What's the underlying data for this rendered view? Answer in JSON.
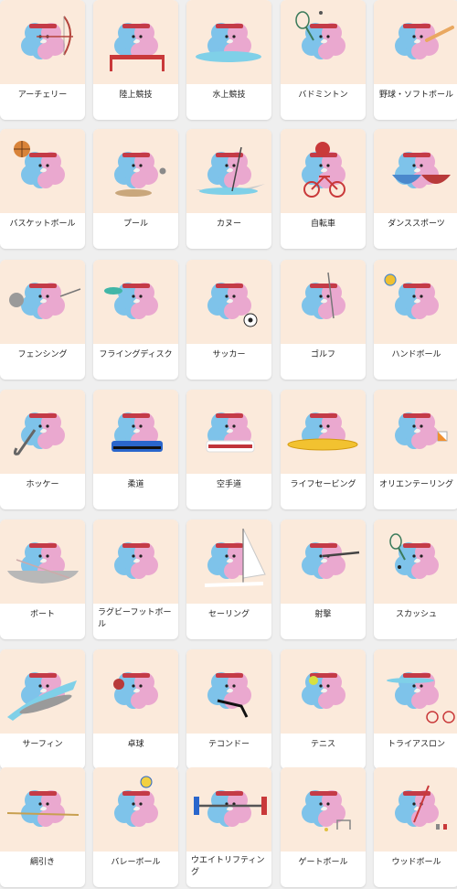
{
  "sports": [
    {
      "label": "アーチェリー",
      "icon": "archery-icon",
      "prop": "bow"
    },
    {
      "label": "陸上競技",
      "icon": "athletics-icon",
      "prop": "hurdle"
    },
    {
      "label": "水上競技",
      "icon": "aquatics-icon",
      "prop": "water"
    },
    {
      "label": "バドミントン",
      "icon": "badminton-icon",
      "prop": "racket"
    },
    {
      "label": "野球・ソフトボール",
      "icon": "baseball-softball-icon",
      "prop": "bat"
    },
    {
      "label": "バスケットボール",
      "icon": "basketball-icon",
      "prop": "basketball"
    },
    {
      "label": "プール",
      "icon": "boules-icon",
      "prop": "boules"
    },
    {
      "label": "カヌー",
      "icon": "canoe-icon",
      "prop": "canoe"
    },
    {
      "label": "自転車",
      "icon": "cycling-icon",
      "prop": "bicycle"
    },
    {
      "label": "ダンススポーツ",
      "icon": "dancesport-icon",
      "prop": "dance"
    },
    {
      "label": "フェンシング",
      "icon": "fencing-icon",
      "prop": "fencing"
    },
    {
      "label": "フライングディスク",
      "icon": "flying-disc-icon",
      "prop": "disc"
    },
    {
      "label": "サッカー",
      "icon": "football-icon",
      "prop": "soccerball"
    },
    {
      "label": "ゴルフ",
      "icon": "golf-icon",
      "prop": "golf"
    },
    {
      "label": "ハンドボール",
      "icon": "handball-icon",
      "prop": "handball"
    },
    {
      "label": "ホッケー",
      "icon": "hockey-icon",
      "prop": "hockey"
    },
    {
      "label": "柔道",
      "icon": "judo-icon",
      "prop": "judo"
    },
    {
      "label": "空手道",
      "icon": "karate-icon",
      "prop": "karate"
    },
    {
      "label": "ライフセービング",
      "icon": "lifesaving-icon",
      "prop": "board"
    },
    {
      "label": "オリエンテーリング",
      "icon": "orienteering-icon",
      "prop": "flag"
    },
    {
      "label": "ボート",
      "icon": "rowing-icon",
      "prop": "boat"
    },
    {
      "label": "ラグビーフットボール",
      "icon": "rugby-icon",
      "prop": "rugby",
      "wrap": true
    },
    {
      "label": "セーリング",
      "icon": "sailing-icon",
      "prop": "sail"
    },
    {
      "label": "射撃",
      "icon": "shooting-icon",
      "prop": "rifle"
    },
    {
      "label": "スカッシュ",
      "icon": "squash-icon",
      "prop": "squash"
    },
    {
      "label": "サーフィン",
      "icon": "surfing-icon",
      "prop": "surf"
    },
    {
      "label": "卓球",
      "icon": "table-tennis-icon",
      "prop": "paddle"
    },
    {
      "label": "テコンドー",
      "icon": "taekwondo-icon",
      "prop": "taekwondo"
    },
    {
      "label": "テニス",
      "icon": "tennis-icon",
      "prop": "tennis"
    },
    {
      "label": "トライアスロン",
      "icon": "triathlon-icon",
      "prop": "triathlon"
    },
    {
      "label": "綱引き",
      "icon": "tug-of-war-icon",
      "prop": "rope"
    },
    {
      "label": "バレーボール",
      "icon": "volleyball-icon",
      "prop": "volleyball"
    },
    {
      "label": "ウエイトリフティング",
      "icon": "weightlifting-icon",
      "prop": "barbell",
      "wrap": true
    },
    {
      "label": "ゲートボール",
      "icon": "gateball-icon",
      "prop": "gate"
    },
    {
      "label": "ウッドボール",
      "icon": "woodball-icon",
      "prop": "woodball"
    }
  ]
}
